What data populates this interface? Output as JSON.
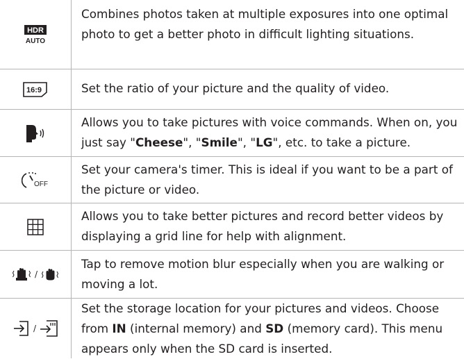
{
  "rows": [
    {
      "icon": "hdr-auto-icon",
      "icon_text_top": "HDR",
      "icon_text_bottom": "AUTO",
      "text": "Combines photos taken at multiple exposures into one optimal photo to get a better photo in difficult lighting situations."
    },
    {
      "icon": "aspect-ratio-icon",
      "icon_text": "16:9",
      "text": "Set the ratio of your picture and the quality of video."
    },
    {
      "icon": "voice-shutter-icon",
      "text_parts": [
        "Allows you to take pictures with voice commands. When on, you just say \"",
        "Cheese",
        "\", \"",
        "Smile",
        "\", \"",
        "LG",
        "\", etc. to take a picture."
      ]
    },
    {
      "icon": "timer-off-icon",
      "icon_text": "OFF",
      "text": "Set your camera's timer. This is ideal if you want to be a part of the picture or video."
    },
    {
      "icon": "grid-icon",
      "text": "Allows you to take better pictures and record better videos by displaying a grid line for help with alignment."
    },
    {
      "icon": "steady-shot-icon",
      "separator": "/",
      "text": "Tap to remove motion blur especially when you are walking or moving a lot."
    },
    {
      "icon": "storage-location-icon",
      "separator": "/",
      "text_parts": [
        "Set the storage location for your pictures and videos. Choose from ",
        "IN",
        " (internal memory) and ",
        "SD",
        " (memory card). This menu appears only when the SD card is inserted."
      ]
    }
  ],
  "colors": {
    "text": "#231f20",
    "border": "#b5b5b5"
  }
}
